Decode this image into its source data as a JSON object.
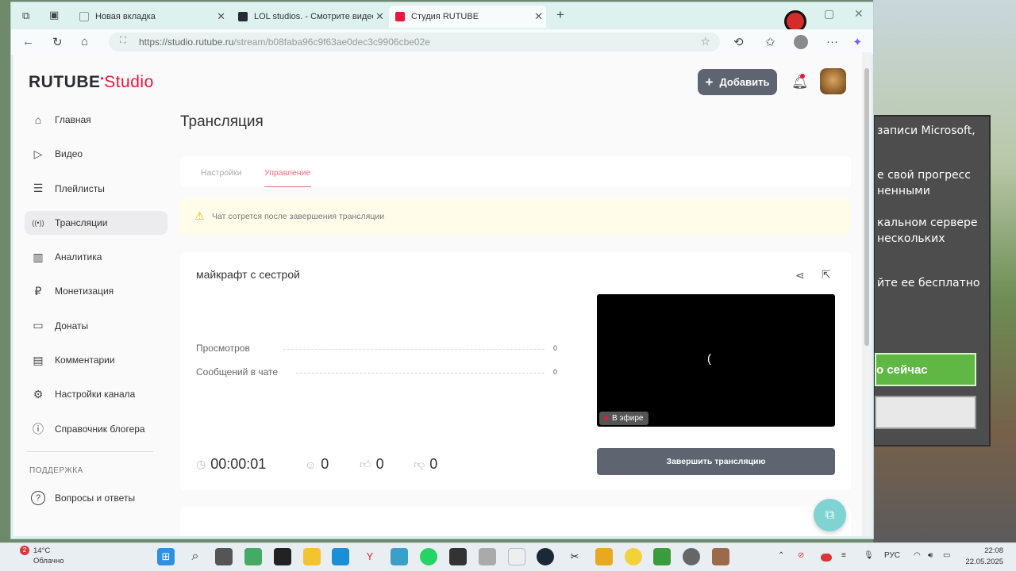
{
  "background_app": {
    "lines": [
      "записи Microsoft,",
      "е свой прогресс",
      "ненными",
      "кальном сервере",
      "нескольких",
      "йте ее бесплатно"
    ],
    "green_button": "о сейчас"
  },
  "browser": {
    "tabs": [
      {
        "label": "Новая вкладка",
        "active": false
      },
      {
        "label": "LOL studios. - Смотрите видео о...",
        "active": false
      },
      {
        "label": "Студия RUTUBE",
        "active": true
      }
    ],
    "new_tab": "+",
    "url_host": "https://studio.rutube.ru",
    "url_path": "/stream/b08faba96c9f63ae0dec3c9906cbe02e"
  },
  "header": {
    "logo_main": "RUTUBE",
    "logo_studio": "Studio",
    "add_button": "Добавить"
  },
  "sidebar": {
    "items": [
      {
        "label": "Главная",
        "icon": "home-icon",
        "glyph": "⌂"
      },
      {
        "label": "Видео",
        "icon": "video-icon",
        "glyph": "▷"
      },
      {
        "label": "Плейлисты",
        "icon": "playlist-icon",
        "glyph": "☰"
      },
      {
        "label": "Трансляции",
        "icon": "broadcast-icon",
        "glyph": "((•))",
        "active": true
      },
      {
        "label": "Аналитика",
        "icon": "analytics-icon",
        "glyph": "▥"
      },
      {
        "label": "Монетизация",
        "icon": "ruble-icon",
        "glyph": "₽"
      },
      {
        "label": "Донаты",
        "icon": "wallet-icon",
        "glyph": "▭"
      },
      {
        "label": "Комментарии",
        "icon": "comment-icon",
        "glyph": "▤"
      },
      {
        "label": "Настройки канала",
        "icon": "gear-icon",
        "glyph": "⚙"
      },
      {
        "label": "Справочник блогера",
        "icon": "info-icon",
        "glyph": "ⓘ"
      }
    ],
    "section_support": "ПОДДЕРЖКА",
    "support_items": [
      {
        "label": "Вопросы и ответы",
        "icon": "question-icon",
        "glyph": "?"
      }
    ]
  },
  "main": {
    "title": "Трансляция",
    "tabs": [
      {
        "label": "Настройки",
        "active": false
      },
      {
        "label": "Управление",
        "active": true
      }
    ],
    "warning": "Чат сотрется после завершения трансляции",
    "stream": {
      "title": "майкрафт с сестрой",
      "stats": [
        {
          "label": "Просмотров",
          "value": "0"
        },
        {
          "label": "Сообщений в чате",
          "value": "0"
        }
      ],
      "live_badge": "В эфире",
      "end_button": "Завершить трансляцию",
      "duration": "00:00:01",
      "viewers": "0",
      "likes": "0",
      "dislikes": "0"
    }
  },
  "taskbar": {
    "weather_badge": "2",
    "temp": "14°C",
    "condition": "Облачно",
    "lang": "РУС",
    "time": "22:08",
    "date": "22.05.2025"
  },
  "colors": {
    "accent": "#ed143d",
    "button_dark": "#5e6470",
    "tab_active": "#ed6b79",
    "warning_bg": "#fffde9"
  }
}
